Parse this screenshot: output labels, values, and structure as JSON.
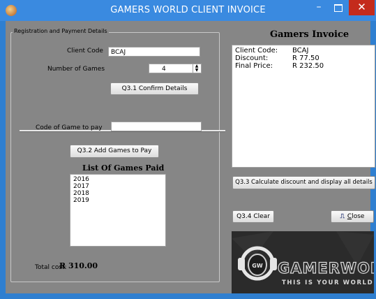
{
  "window": {
    "title": "GAMERS WORLD CLIENT INVOICE",
    "min_glyph": "–",
    "close_glyph": "✕"
  },
  "registration": {
    "group_title": "Registration and Payment Details",
    "client_code_label": "Client Code",
    "client_code_value": "BCAJ",
    "num_games_label": "Number of Games",
    "num_games_value": "4",
    "confirm_button": "Q3.1 Confirm Details"
  },
  "games": {
    "code_label": "Code of Game to pay",
    "code_value": "",
    "add_button": "Q3.2 Add Games to Pay",
    "list_title": "List Of Games Paid",
    "items": [
      "2016",
      "2017",
      "2018",
      "2019"
    ],
    "total_label": "Total cost:",
    "total_value": "R 310.00"
  },
  "invoice": {
    "title": "Gamers Invoice",
    "rows": [
      {
        "key": "Client Code:",
        "value": "BCAJ"
      },
      {
        "key": "Discount:",
        "value": "R 77.50"
      },
      {
        "key": "Final Price:",
        "value": "R 232.50"
      }
    ],
    "calc_button": "Q3.3 Calculate discount and display all details",
    "clear_button": "Q3.4 Clear",
    "close_button_underlined": "C",
    "close_button_rest": "lose"
  },
  "logo": {
    "brand": "GAMERWORLD",
    "tagline": "THIS IS YOUR WORLD",
    "badge": "GW"
  }
}
